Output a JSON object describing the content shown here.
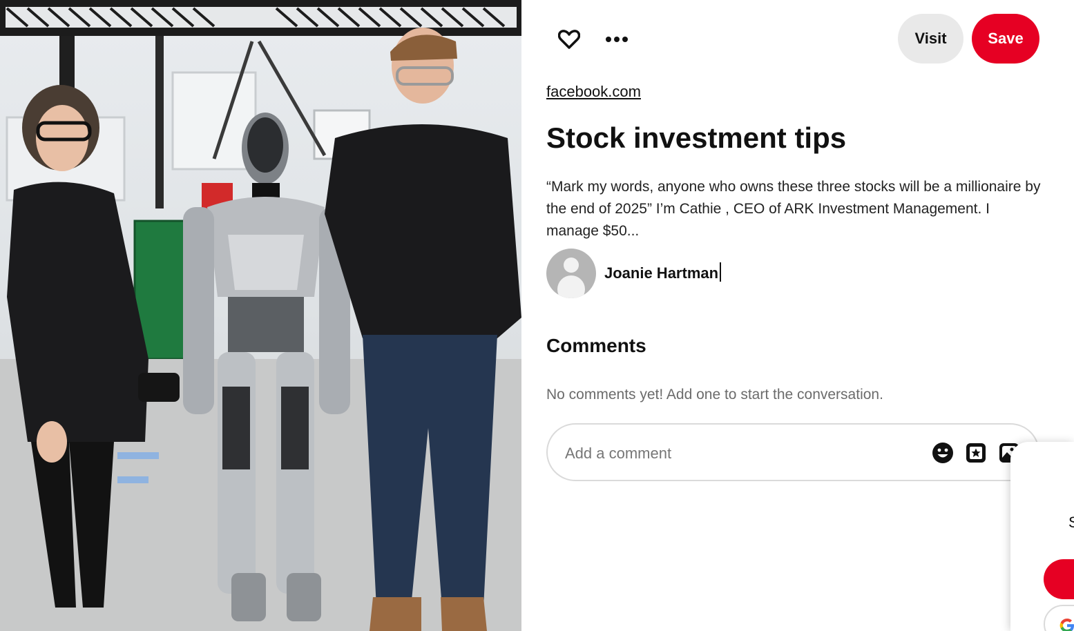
{
  "pin": {
    "image_alt": "Photo of a woman and a man standing beside a silver humanoid robot in a workshop",
    "source": "facebook.com",
    "title": "Stock investment tips",
    "description": "“Mark my words, anyone who owns these three stocks will be a millionaire by the end of 2025” I’m Cathie , CEO of ARK Investment Management. I manage $50...",
    "creator_name": "Joanie Hartman"
  },
  "actions": {
    "visit_label": "Visit",
    "save_label": "Save",
    "heart_icon": "heart-icon",
    "more_icon": "more-options-icon"
  },
  "comments": {
    "heading": "Comments",
    "empty_text": "No comments yet! Add one to start the conversation.",
    "input_placeholder": "Add a comment",
    "icons": [
      "emoji-icon",
      "sticker-icon",
      "image-icon"
    ]
  },
  "popup": {
    "visible_letter": "S"
  },
  "colors": {
    "accent_red": "#e60023",
    "visit_bg": "#e9e9e9",
    "muted_text": "#6b6b6b"
  }
}
